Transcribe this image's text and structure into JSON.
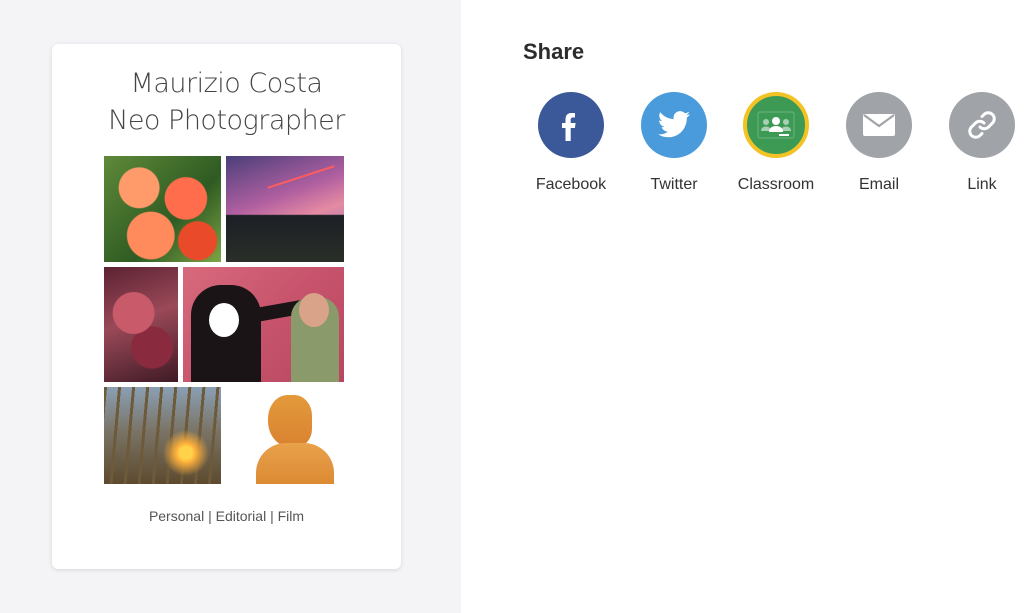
{
  "card": {
    "title_line1": "Maurizio Costa",
    "title_line2": "Neo Photographer",
    "footer": "Personal | Editorial | Film"
  },
  "share": {
    "title": "Share",
    "items": [
      {
        "label": "Facebook",
        "icon": "facebook-icon",
        "color": "#3b5998"
      },
      {
        "label": "Twitter",
        "icon": "twitter-icon",
        "color": "#4a9bdc"
      },
      {
        "label": "Classroom",
        "icon": "google-classroom-icon",
        "color": "#3c9a55"
      },
      {
        "label": "Email",
        "icon": "email-icon",
        "color": "#a0a3a8"
      },
      {
        "label": "Link",
        "icon": "link-icon",
        "color": "#a0a3a8"
      }
    ]
  }
}
